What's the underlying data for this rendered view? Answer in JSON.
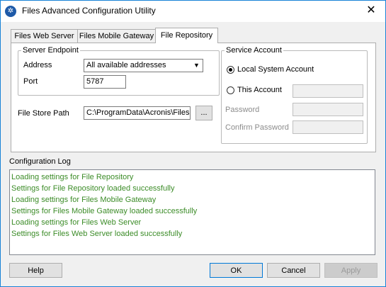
{
  "window": {
    "title": "Files Advanced Configuration Utility",
    "close_glyph": "✕",
    "icon_glyph": "✲"
  },
  "tabs": [
    {
      "label": "Files Web Server",
      "active": false
    },
    {
      "label": "Files Mobile Gateway",
      "active": false
    },
    {
      "label": "File Repository",
      "active": true
    }
  ],
  "server_endpoint": {
    "legend": "Server Endpoint",
    "address_label": "Address",
    "address_value": "All available addresses",
    "port_label": "Port",
    "port_value": "5787"
  },
  "file_store": {
    "label": "File Store Path",
    "value": "C:\\ProgramData\\Acronis\\Files",
    "browse_label": "..."
  },
  "service_account": {
    "legend": "Service Account",
    "local_system_label": "Local System Account",
    "local_system_selected": true,
    "this_account_label": "This Account",
    "this_account_value": "",
    "password_label": "Password",
    "password_value": "",
    "confirm_password_label": "Confirm Password",
    "confirm_password_value": ""
  },
  "log": {
    "label": "Configuration Log",
    "lines": [
      "Loading settings for File Repository",
      "Settings for File Repository loaded successfully",
      "Loading settings for Files Mobile Gateway",
      "Settings for Files Mobile Gateway loaded successfully",
      "Loading settings for Files Web Server",
      "Settings for Files Web Server loaded successfully"
    ]
  },
  "buttons": {
    "help": "Help",
    "ok": "OK",
    "cancel": "Cancel",
    "apply": "Apply"
  },
  "colors": {
    "log_text": "#3c8c28",
    "window_border": "#1883d7",
    "accent": "#0078d7"
  }
}
